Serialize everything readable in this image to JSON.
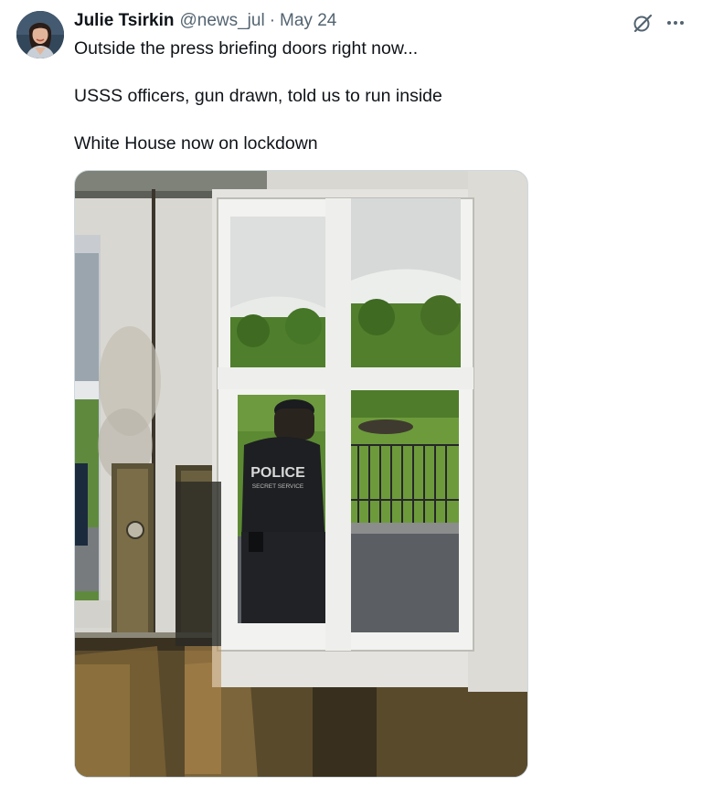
{
  "tweet": {
    "author": {
      "name": "Julie Tsirkin",
      "handle": "@news_jul",
      "separator": "·",
      "date": "May 24"
    },
    "icons": [
      "grok-icon",
      "more-icon"
    ],
    "text": {
      "line1": "Outside the press briefing doors right now...",
      "line2": "USSS officers, gun drawn, told us to run inside",
      "line3": "White House now on lockdown"
    },
    "media": {
      "vest_text_1": "POLICE",
      "vest_text_2": "SECRET SERVICE"
    }
  }
}
